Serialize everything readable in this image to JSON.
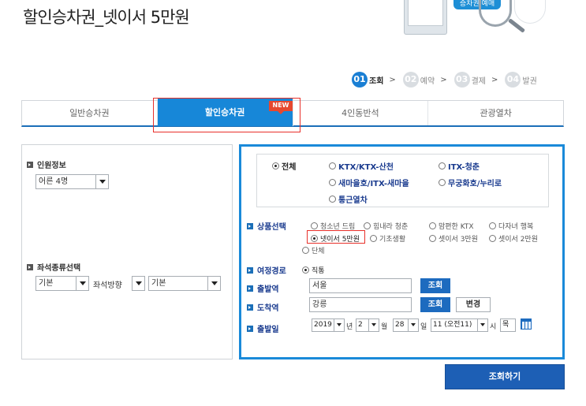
{
  "header": {
    "title": "할인승차권_넷이서 5만원",
    "banner_text": "승차권 예매"
  },
  "steps": [
    {
      "num": "01",
      "label": "조회",
      "active": true
    },
    {
      "num": "02",
      "label": "예약",
      "active": false
    },
    {
      "num": "03",
      "label": "결제",
      "active": false
    },
    {
      "num": "04",
      "label": "발권",
      "active": false
    }
  ],
  "step_separator": ">",
  "tabs": [
    {
      "label": "일반승차권"
    },
    {
      "label": "할인승차권"
    },
    {
      "label": "4인동반석"
    },
    {
      "label": "관광열차"
    }
  ],
  "new_badge": "NEW",
  "left": {
    "passenger_label": "인원정보",
    "passenger_value": "어른 4명",
    "seat_label": "좌석종류선택",
    "seat_type": "기본",
    "seat_dir_label": "좌석방향",
    "seat_dir": "기본"
  },
  "train_types": [
    {
      "label": "전체",
      "checked": true
    },
    {
      "label": "KTX/KTX-산천",
      "checked": false
    },
    {
      "label": "ITX-청춘",
      "checked": false
    },
    {
      "label": "새마을호/ITX-새마을",
      "checked": false
    },
    {
      "label": "무궁화호/누리로",
      "checked": false
    },
    {
      "label": "통근열차",
      "checked": false
    }
  ],
  "product": {
    "label": "상품선택",
    "options": [
      {
        "label": "청소년 드림",
        "checked": false
      },
      {
        "label": "힘내라 청춘",
        "checked": false
      },
      {
        "label": "맘편한 KTX",
        "checked": false
      },
      {
        "label": "다자녀 행복",
        "checked": false
      },
      {
        "label": "넷이서 5만원",
        "checked": true
      },
      {
        "label": "기초생활",
        "checked": false
      },
      {
        "label": "셋이서 3만원",
        "checked": false
      },
      {
        "label": "셋이서 2만원",
        "checked": false
      },
      {
        "label": "단체",
        "checked": false
      }
    ]
  },
  "route": {
    "label": "여정경로",
    "option": "직통"
  },
  "departure": {
    "label": "출발역",
    "value": "서울",
    "button": "조회"
  },
  "arrival": {
    "label": "도착역",
    "value": "강릉",
    "button": "조회",
    "swap_button": "변경"
  },
  "date": {
    "label": "출발일",
    "year": "2019",
    "year_unit": "년",
    "month": "2",
    "month_unit": "월",
    "day": "28",
    "day_unit": "일",
    "hour": "11 (오전11)",
    "hour_unit": "시",
    "weekday": "목"
  },
  "search_button": "조회하기",
  "colors": {
    "accent": "#1787d8",
    "highlight": "#e8302a",
    "label_blue": "#1a3b8f"
  }
}
